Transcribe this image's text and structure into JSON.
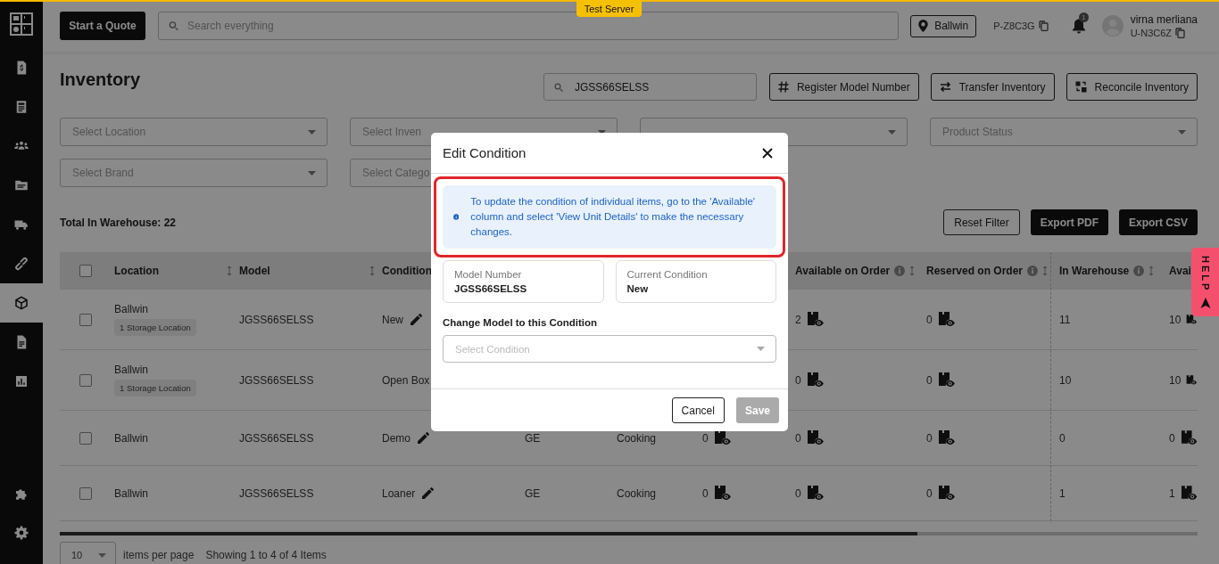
{
  "test_server_badge": "Test Server",
  "sidebar": {
    "items": [
      {
        "selected": false
      },
      {
        "selected": false
      },
      {
        "selected": false
      },
      {
        "selected": false
      },
      {
        "selected": false
      },
      {
        "selected": false
      },
      {
        "selected": true
      },
      {
        "selected": false
      },
      {
        "selected": false
      }
    ],
    "bottom_items": [
      {
        "selected": false
      },
      {
        "selected": false
      }
    ]
  },
  "header": {
    "quote_button": "Start a Quote",
    "search": {
      "placeholder": "Search everything"
    },
    "location": "Ballwin",
    "store_code": "P-Z8C3G",
    "notification_count": "1",
    "user": {
      "name": "virna merliana",
      "code": "U-N3C6Z"
    }
  },
  "page": {
    "title": "Inventory",
    "search": {
      "value": "JGSS66SELSS"
    },
    "actions": [
      {
        "label": "Register Model Number",
        "kind": "hash"
      },
      {
        "label": "Transfer Inventory",
        "kind": "transfer"
      },
      {
        "label": "Reconcile Inventory",
        "kind": "reconcile"
      }
    ],
    "filters": [
      {
        "kind": "dropdown",
        "placeholder": "Select Location"
      },
      {
        "kind": "dropdown",
        "placeholder": "Select Inven"
      },
      {
        "kind": "dropdown"
      },
      {
        "kind": "dropdown",
        "placeholder": "Product Status"
      },
      {
        "kind": "dropdown",
        "placeholder": "Select Brand"
      },
      {
        "kind": "dropdown",
        "placeholder": "Select Catego"
      }
    ],
    "total": "Total In Warehouse: 22",
    "buttons": [
      {
        "label": "Reset Filter",
        "kind": "outline"
      },
      {
        "label": "Export PDF",
        "kind": "dark"
      },
      {
        "label": "Export CSV",
        "kind": "dark"
      }
    ]
  },
  "table": {
    "columns": [
      {
        "kind": "checkbox",
        "checked": false
      },
      {
        "kind": "location",
        "label": "Location",
        "sortable": true,
        "info": false
      },
      {
        "kind": "model",
        "label": "Model",
        "sortable": true,
        "info": false
      },
      {
        "kind": "condition",
        "label": "Condition"
      },
      {
        "kind": "on_order",
        "label": "Available on Order",
        "sortable": true,
        "info": true
      },
      {
        "kind": "reserved",
        "label": "Reserved on Order",
        "sortable": true,
        "info": true
      },
      {
        "kind": "in_warehouse",
        "label": "In Warehouse",
        "sortable": true,
        "info": true
      },
      {
        "kind": "avail",
        "label": "Avai"
      }
    ],
    "rows": [
      {
        "checked": false,
        "location": "Ballwin",
        "tag": "1 Storage Location",
        "model": "JGSS66SELSS",
        "condition": "New",
        "edit_icon": true,
        "on_order": "2",
        "reserved": "0",
        "in_warehouse": "11",
        "avail": "10"
      },
      {
        "checked": false,
        "location": "Ballwin",
        "tag": "1 Storage Location",
        "model": "JGSS66SELSS",
        "condition": "Open Box",
        "on_order": "0",
        "reserved": "0",
        "in_warehouse": "10",
        "avail": "10"
      },
      {
        "checked": false,
        "location": "Ballwin",
        "model": "JGSS66SELSS",
        "condition": "Demo",
        "edit_icon": true,
        "brand": "GE",
        "category": "Cooking",
        "available": "0",
        "on_order": "0",
        "reserved": "0",
        "in_warehouse": "0",
        "avail": "0"
      },
      {
        "checked": false,
        "location": "Ballwin",
        "model": "JGSS66SELSS",
        "condition": "Loaner",
        "edit_icon": true,
        "brand": "GE",
        "category": "Cooking",
        "available": "0",
        "on_order": "0",
        "reserved": "0",
        "in_warehouse": "1",
        "avail": "1"
      }
    ]
  },
  "pagination": {
    "per_page": "10",
    "per_page_label": "items per page",
    "summary": "Showing 1 to 4 of 4 Items"
  },
  "help_tab": "HELP",
  "modal": {
    "title": "Edit Condition",
    "notice": {
      "text": "To update the condition of individual items, go to the 'Available' column and select 'View Unit Details' to make the necessary changes.",
      "highlighted": true
    },
    "fields": [
      {
        "label": "Model Number",
        "value": "JGSS66SELSS"
      },
      {
        "label": "Current Condition",
        "value": "New"
      }
    ],
    "change_label": "Change Model to this Condition",
    "select": {
      "placeholder": "Select Condition"
    },
    "buttons": [
      {
        "label": "Cancel",
        "kind": "outline",
        "disabled": false
      },
      {
        "label": "Save",
        "kind": "primary",
        "disabled": true
      }
    ]
  }
}
